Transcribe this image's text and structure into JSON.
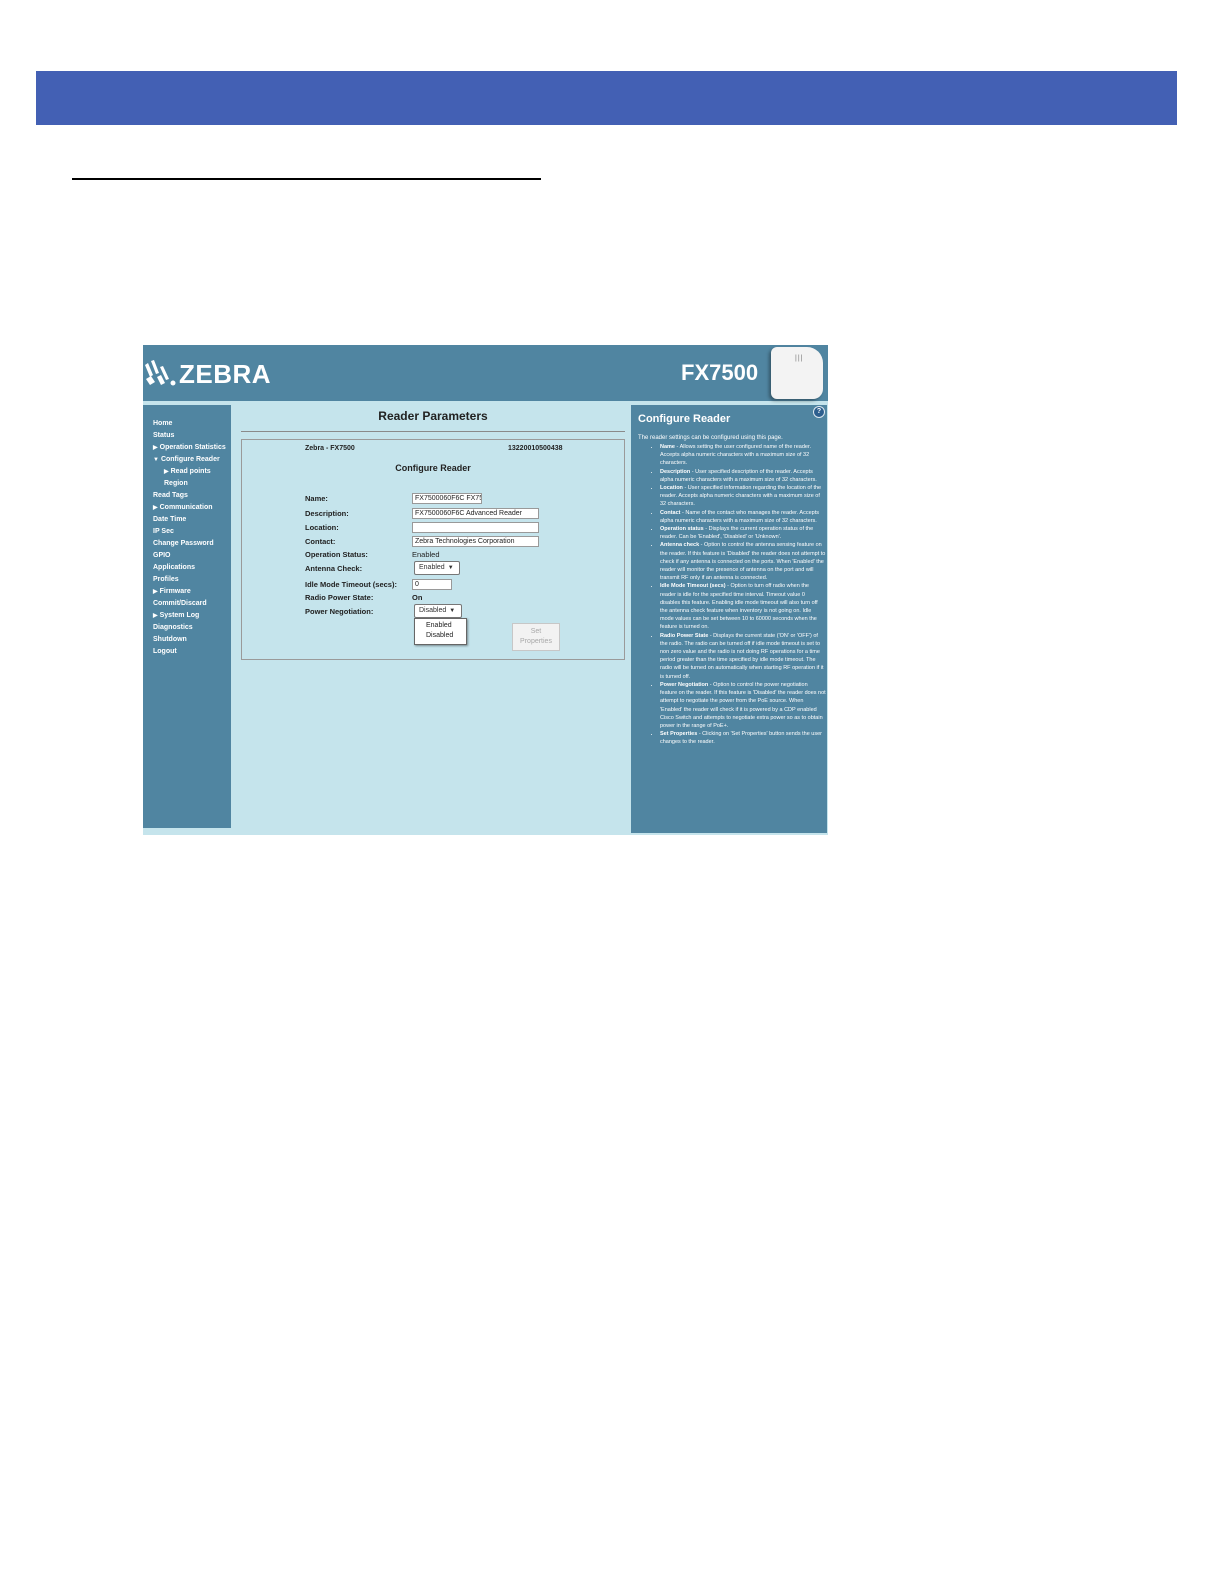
{
  "app": {
    "brand": "ZEBRA",
    "model": "FX7500",
    "device_leds": "|||"
  },
  "nav": {
    "items": [
      {
        "label": "Home"
      },
      {
        "label": "Status"
      },
      {
        "label": "Operation Statistics",
        "collapsed": true
      },
      {
        "label": "Configure Reader",
        "expanded": true
      },
      {
        "label": "Read points",
        "collapsed": true
      },
      {
        "label": "Region"
      },
      {
        "label": "Read Tags"
      },
      {
        "label": "Communication",
        "collapsed": true
      },
      {
        "label": "Date Time"
      },
      {
        "label": "IP Sec"
      },
      {
        "label": "Change Password"
      },
      {
        "label": "GPIO"
      },
      {
        "label": "Applications"
      },
      {
        "label": "Profiles"
      },
      {
        "label": "Firmware",
        "collapsed": true
      },
      {
        "label": "Commit/Discard"
      },
      {
        "label": "System Log",
        "collapsed": true
      },
      {
        "label": "Diagnostics"
      },
      {
        "label": "Shutdown"
      },
      {
        "label": "Logout"
      }
    ]
  },
  "main": {
    "title": "Reader Parameters",
    "reader_name": "Zebra - FX7500",
    "serial": "13220010500438",
    "section_title": "Configure Reader",
    "form": {
      "name_label": "Name:",
      "name_value": "FX7500060F6C FX75",
      "description_label": "Description:",
      "description_value": "FX7500060F6C Advanced Reader",
      "location_label": "Location:",
      "location_value": "",
      "contact_label": "Contact:",
      "contact_value": "Zebra Technologies Corporation",
      "operation_status_label": "Operation Status:",
      "operation_status_value": "Enabled",
      "antenna_check_label": "Antenna Check:",
      "antenna_check_value": "Enabled",
      "idle_timeout_label": "Idle Mode Timeout (secs):",
      "idle_timeout_value": "0",
      "radio_power_label": "Radio Power State:",
      "radio_power_value": "On",
      "power_negotiation_label": "Power Negotiation:",
      "power_negotiation_value": "Disabled",
      "power_negotiation_options": [
        "Enabled",
        "Disabled"
      ],
      "set_button_line1": "Set",
      "set_button_line2": "Properties"
    }
  },
  "help": {
    "icon": "?",
    "title": "Configure Reader",
    "intro": "The reader settings can be configured using this page.",
    "items": [
      {
        "term": "Name",
        "text": " - Allows setting the user configured name of the reader. Accepts alpha numeric characters with a maximum size of 32 characters."
      },
      {
        "term": "Description",
        "text": " - User specified description of the reader. Accepts alpha numeric characters with a maximum size of 32 characters."
      },
      {
        "term": "Location",
        "text": " - User specified information regarding the location of the reader. Accepts alpha numeric characters with a maximum size of 32 characters."
      },
      {
        "term": "Contact",
        "text": " - Name of the contact who manages the reader. Accepts alpha numeric characters with a maximum size of 32 characters."
      },
      {
        "term": "Operation status",
        "text": " - Displays the current operation status of the reader. Can be 'Enabled', 'Disabled' or 'Unknown'."
      },
      {
        "term": "Antenna check",
        "text": " - Option to control the antenna sensing feature on the reader. If this feature is 'Disabled' the reader does not attempt to check if any antenna is connected on the ports. When 'Enabled' the reader will monitor the presence of antenna on the port and will transmit RF only if an antenna is connected."
      },
      {
        "term": "Idle Mode Timeout (secs)",
        "text": " - Option to turn off radio when the reader is idle for the specified time interval. Timeout value 0 disables this feature. Enabling idle mode timeout will also turn off the antenna check feature when inventory is not going on. Idle mode values can be set between 10 to 60000 seconds when the feature is turned on."
      },
      {
        "term": "Radio Power State",
        "text": " - Displays the current state ('ON' or 'OFF') of the radio. The radio can be turned off if idle mode timeout is set to non zero value and the radio is not doing RF operations for a time period greater than the time specified by idle mode timeout. The radio will be turned on automatically when starting RF operation if it is turned off."
      },
      {
        "term": "Power Negotiation",
        "text": " - Option to control the power negotiation feature on the reader. If this feature is 'Disabled' the reader does not attempt to negotiate the power from the PoE source. When 'Enabled' the reader will check if it is powered by a CDP enabled Cisco Switch and attempts to negotiate extra power so as to obtain power in the range of PoE+."
      },
      {
        "term": "Set Properties",
        "text": " - Clicking on 'Set Properties' button sends the user changes to the reader."
      }
    ]
  }
}
